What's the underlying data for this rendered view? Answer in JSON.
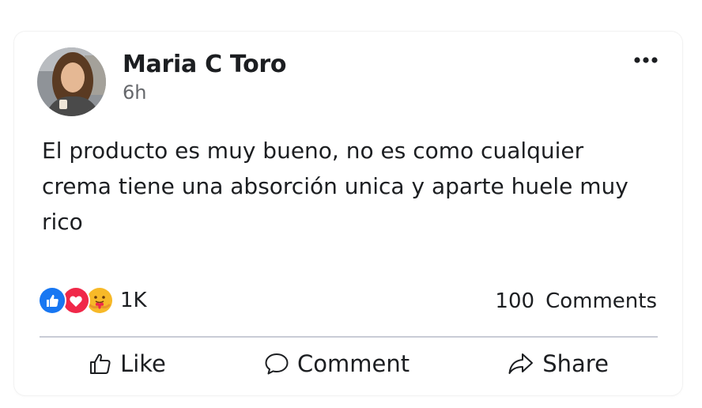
{
  "post": {
    "author": "Maria C Toro",
    "time": "6h",
    "text": "El producto es muy bueno, no es como cualquier crema tiene una absorción unica y aparte huele muy rico",
    "reactions": {
      "icons": [
        "like-icon",
        "love-icon",
        "care-icon"
      ],
      "count": "1K"
    },
    "comments": {
      "count": "100",
      "label": "Comments"
    }
  },
  "actions": {
    "like": "Like",
    "comment": "Comment",
    "share": "Share"
  },
  "colors": {
    "like_blue": "#1877f2",
    "love_red": "#f02849",
    "care_yellow": "#f7b928",
    "text_primary": "#1c1e21",
    "text_secondary": "#65676b",
    "divider": "#c9ccd6"
  }
}
